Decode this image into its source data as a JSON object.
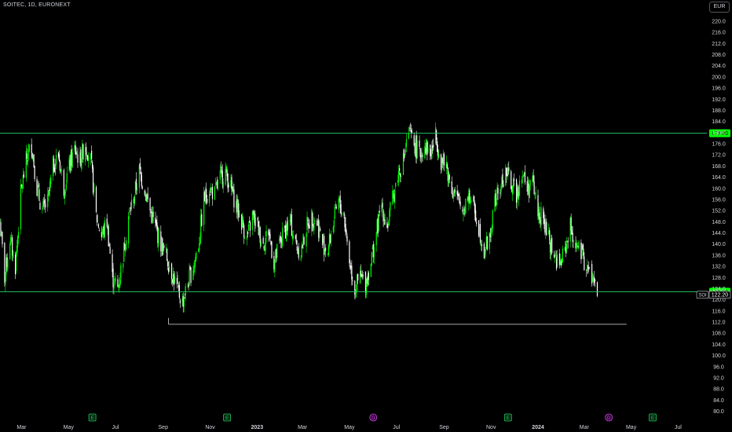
{
  "header": {
    "symbol": "SOITEC, 1D, EURONEXT",
    "currency": "EUR"
  },
  "colors": {
    "background": "#000000",
    "up": "#00ff00",
    "down": "#ffffff",
    "hline": "#22c55e",
    "text": "#d1d4dc",
    "earnings": "#22c55e",
    "dividend": "#d946ef"
  },
  "chart_data": {
    "type": "candlestick",
    "title": "SOITEC, 1D, EURONEXT",
    "y_ticks": [
      220.0,
      216.0,
      212.0,
      208.0,
      204.0,
      200.0,
      196.0,
      192.0,
      188.0,
      184.0,
      180.0,
      176.0,
      172.0,
      168.0,
      164.0,
      160.0,
      156.0,
      152.0,
      148.0,
      144.0,
      140.0,
      136.0,
      132.0,
      128.0,
      124.0,
      120.0,
      116.0,
      112.0,
      108.0,
      104.0,
      100.0,
      96.0,
      92.0,
      88.0,
      84.0,
      80.0
    ],
    "x_ticks": [
      "Mar",
      "May",
      "Jul",
      "Sep",
      "Nov",
      "2023",
      "Mar",
      "May",
      "Jul",
      "Sep",
      "Nov",
      "2024",
      "Mar",
      "May",
      "Jul"
    ],
    "ylim": [
      78,
      222
    ],
    "horizontal_lines": [
      {
        "price": 179.8,
        "label": "179.80"
      },
      {
        "price": 122.88,
        "label": "122.88"
      }
    ],
    "support_segment": {
      "price": 111.2,
      "from": "2022-09-08",
      "to": "2024-04-25"
    },
    "last_price": {
      "symbol": "SOI",
      "label": "122.20",
      "value": 122.2
    },
    "path": [
      [
        "2022-02-01",
        148
      ],
      [
        "2022-02-07",
        128
      ],
      [
        "2022-02-14",
        142
      ],
      [
        "2022-02-21",
        132
      ],
      [
        "2022-02-28",
        158
      ],
      [
        "2022-03-07",
        170
      ],
      [
        "2022-03-14",
        176
      ],
      [
        "2022-03-21",
        160
      ],
      [
        "2022-03-28",
        152
      ],
      [
        "2022-04-04",
        155
      ],
      [
        "2022-04-11",
        168
      ],
      [
        "2022-04-18",
        172
      ],
      [
        "2022-04-25",
        160
      ],
      [
        "2022-05-02",
        168
      ],
      [
        "2022-05-09",
        174
      ],
      [
        "2022-05-16",
        170
      ],
      [
        "2022-05-23",
        176
      ],
      [
        "2022-05-30",
        170
      ],
      [
        "2022-06-06",
        150
      ],
      [
        "2022-06-13",
        143
      ],
      [
        "2022-06-20",
        148
      ],
      [
        "2022-06-27",
        128
      ],
      [
        "2022-07-04",
        124
      ],
      [
        "2022-07-11",
        136
      ],
      [
        "2022-07-18",
        150
      ],
      [
        "2022-07-25",
        157
      ],
      [
        "2022-08-01",
        166
      ],
      [
        "2022-08-08",
        160
      ],
      [
        "2022-08-15",
        152
      ],
      [
        "2022-08-22",
        146
      ],
      [
        "2022-08-29",
        140
      ],
      [
        "2022-09-05",
        136
      ],
      [
        "2022-09-12",
        130
      ],
      [
        "2022-09-19",
        124
      ],
      [
        "2022-09-26",
        119
      ],
      [
        "2022-10-03",
        126
      ],
      [
        "2022-10-10",
        132
      ],
      [
        "2022-10-17",
        140
      ],
      [
        "2022-10-24",
        156
      ],
      [
        "2022-10-31",
        160
      ],
      [
        "2022-11-07",
        158
      ],
      [
        "2022-11-14",
        164
      ],
      [
        "2022-11-21",
        166
      ],
      [
        "2022-11-28",
        160
      ],
      [
        "2022-12-05",
        154
      ],
      [
        "2022-12-12",
        148
      ],
      [
        "2022-12-19",
        142
      ],
      [
        "2022-12-26",
        150
      ],
      [
        "2023-01-02",
        146
      ],
      [
        "2023-01-09",
        140
      ],
      [
        "2023-01-16",
        145
      ],
      [
        "2023-01-23",
        133
      ],
      [
        "2023-01-30",
        140
      ],
      [
        "2023-02-06",
        145
      ],
      [
        "2023-02-13",
        148
      ],
      [
        "2023-02-20",
        140
      ],
      [
        "2023-02-27",
        137
      ],
      [
        "2023-03-06",
        146
      ],
      [
        "2023-03-13",
        150
      ],
      [
        "2023-03-20",
        148
      ],
      [
        "2023-03-27",
        140
      ],
      [
        "2023-04-03",
        138
      ],
      [
        "2023-04-10",
        148
      ],
      [
        "2023-04-17",
        155
      ],
      [
        "2023-04-24",
        150
      ],
      [
        "2023-05-01",
        134
      ],
      [
        "2023-05-08",
        124
      ],
      [
        "2023-05-15",
        128
      ],
      [
        "2023-05-22",
        126
      ],
      [
        "2023-05-29",
        134
      ],
      [
        "2023-06-05",
        144
      ],
      [
        "2023-06-12",
        154
      ],
      [
        "2023-06-19",
        146
      ],
      [
        "2023-06-26",
        156
      ],
      [
        "2023-07-03",
        165
      ],
      [
        "2023-07-10",
        170
      ],
      [
        "2023-07-17",
        180
      ],
      [
        "2023-07-24",
        176
      ],
      [
        "2023-07-31",
        172
      ],
      [
        "2023-08-07",
        176
      ],
      [
        "2023-08-14",
        172
      ],
      [
        "2023-08-21",
        179
      ],
      [
        "2023-08-28",
        170
      ],
      [
        "2023-09-04",
        168
      ],
      [
        "2023-09-11",
        160
      ],
      [
        "2023-09-18",
        156
      ],
      [
        "2023-09-25",
        152
      ],
      [
        "2023-10-02",
        158
      ],
      [
        "2023-10-09",
        154
      ],
      [
        "2023-10-16",
        146
      ],
      [
        "2023-10-23",
        138
      ],
      [
        "2023-10-30",
        142
      ],
      [
        "2023-11-06",
        155
      ],
      [
        "2023-11-13",
        160
      ],
      [
        "2023-11-20",
        166
      ],
      [
        "2023-11-27",
        162
      ],
      [
        "2023-12-04",
        158
      ],
      [
        "2023-12-11",
        166
      ],
      [
        "2023-12-18",
        160
      ],
      [
        "2023-12-25",
        162
      ],
      [
        "2024-01-01",
        152
      ],
      [
        "2024-01-08",
        148
      ],
      [
        "2024-01-15",
        142
      ],
      [
        "2024-01-22",
        136
      ],
      [
        "2024-01-29",
        132
      ],
      [
        "2024-02-05",
        138
      ],
      [
        "2024-02-12",
        146
      ],
      [
        "2024-02-19",
        140
      ],
      [
        "2024-02-26",
        136
      ],
      [
        "2024-03-04",
        132
      ],
      [
        "2024-03-11",
        128
      ],
      [
        "2024-03-18",
        123
      ]
    ],
    "events": [
      {
        "date": "2022-06-01",
        "type": "E",
        "label": "E"
      },
      {
        "date": "2022-11-23",
        "type": "E",
        "label": "E"
      },
      {
        "date": "2023-06-01",
        "type": "D",
        "label": "D"
      },
      {
        "date": "2023-11-23",
        "type": "E",
        "label": "E"
      },
      {
        "date": "2024-04-02",
        "type": "D",
        "label": "D"
      },
      {
        "date": "2024-05-29",
        "type": "E",
        "label": "E"
      }
    ]
  }
}
